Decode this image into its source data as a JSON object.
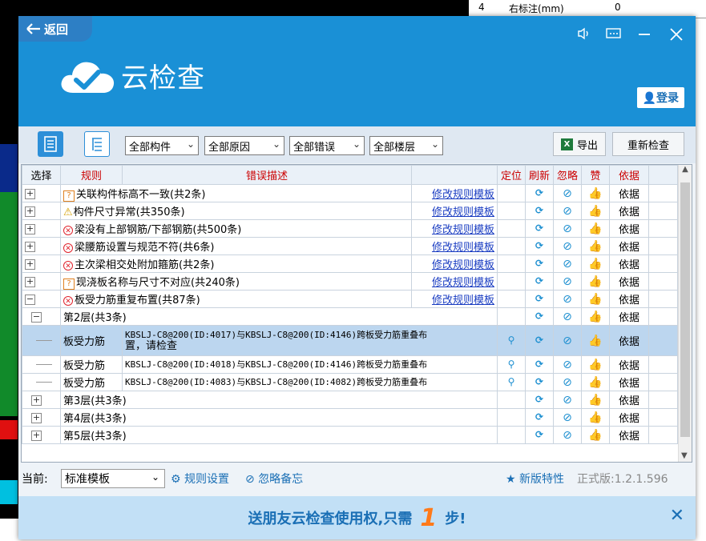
{
  "background": {
    "cell_num": "4",
    "cell_label": "右标注(mm)",
    "cell_value": "0"
  },
  "window": {
    "back_label": "返回",
    "title": "云检查",
    "login_label": "登录",
    "accent_color": "#1a90d6"
  },
  "toolbar": {
    "filters": [
      "全部构件",
      "全部原因",
      "全部错误",
      "全部楼层"
    ],
    "export_label": "导出",
    "recheck_label": "重新检查"
  },
  "grid": {
    "headers": {
      "select": "选择",
      "rule": "规则",
      "desc": "错误描述",
      "locate": "定位",
      "refresh": "刷新",
      "ignore": "忽略",
      "like": "赞",
      "basis": "依据"
    },
    "modify_link": "修改规则模板",
    "basis_label": "依据",
    "groups": [
      {
        "type": "q",
        "text": "关联构件标高不一致(共2条)"
      },
      {
        "type": "warn",
        "text": "构件尺寸异常(共350条)"
      },
      {
        "type": "err",
        "text": "梁没有上部钢筋/下部钢筋(共500条)"
      },
      {
        "type": "err",
        "text": "梁腰筋设置与规范不符(共6条)"
      },
      {
        "type": "err",
        "text": "主次梁相交处附加箍筋(共2条)"
      },
      {
        "type": "q",
        "text": "现浇板名称与尺寸不对应(共240条)"
      },
      {
        "type": "err",
        "text": "板受力筋重复布置(共87条)"
      }
    ],
    "floor_open": "第2层(共3条)",
    "detail_rows": [
      {
        "rule": "板受力筋",
        "desc": "KBSLJ-C8@200(ID:4017)与KBSLJ-C8@200(ID:4146)跨板受力筋重叠布",
        "desc2": "置，请检查"
      },
      {
        "rule": "板受力筋",
        "desc": "KBSLJ-C8@200(ID:4018)与KBSLJ-C8@200(ID:4146)跨板受力筋重叠布",
        "desc2": ""
      },
      {
        "rule": "板受力筋",
        "desc": "KBSLJ-C8@200(ID:4083)与KBSLJ-C8@200(ID:4082)跨板受力筋重叠布",
        "desc2": ""
      }
    ],
    "floors_closed": [
      "第3层(共3条)",
      "第4层(共3条)",
      "第5层(共3条)"
    ]
  },
  "status": {
    "current_label": "当前:",
    "template": "标准模板",
    "rule_settings": "规则设置",
    "ignore_notes": "忽略备忘",
    "new_features": "新版特性",
    "version": "正式版:1.2.1.596"
  },
  "banner": {
    "text_before": "送朋友云检查使用权,只需",
    "number": "1",
    "text_after": "步!"
  }
}
